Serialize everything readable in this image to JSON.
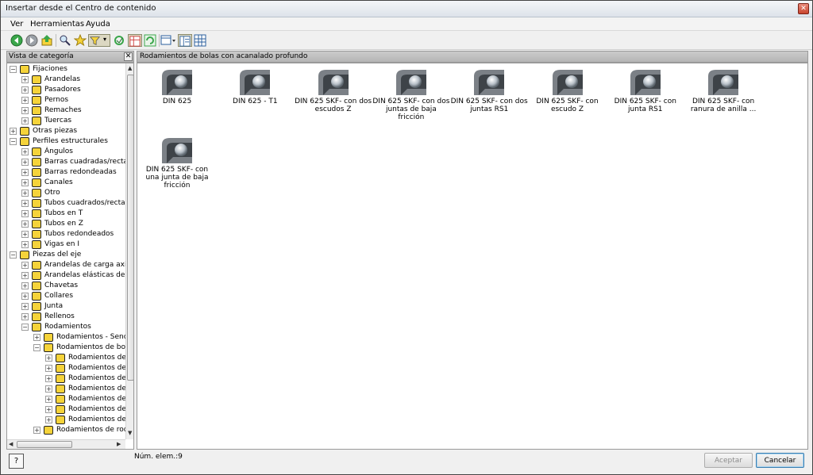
{
  "window": {
    "title": "Insertar desde el Centro de contenido"
  },
  "menu": [
    "Ver",
    "Herramientas",
    "Ayuda"
  ],
  "toolbar": {
    "icons": [
      "back-icon",
      "forward-icon",
      "up-icon",
      "search-icon",
      "favorites-icon",
      "filter-icon",
      "dropdown-icon",
      "refresh-check-icon",
      "table-view-icon",
      "refresh-icon",
      "view-mode-icon",
      "tree-view-icon",
      "grid-view-icon"
    ]
  },
  "sidebar": {
    "header": "Vista de categoría",
    "items": [
      {
        "label": "Fijaciones",
        "level": 0,
        "expanded": true
      },
      {
        "label": "Arandelas",
        "level": 1
      },
      {
        "label": "Pasadores",
        "level": 1
      },
      {
        "label": "Pernos",
        "level": 1
      },
      {
        "label": "Remaches",
        "level": 1
      },
      {
        "label": "Tuercas",
        "level": 1
      },
      {
        "label": "Otras piezas",
        "level": 0
      },
      {
        "label": "Perfiles estructurales",
        "level": 0,
        "expanded": true
      },
      {
        "label": "Ángulos",
        "level": 1
      },
      {
        "label": "Barras cuadradas/rectan",
        "level": 1
      },
      {
        "label": "Barras redondeadas",
        "level": 1
      },
      {
        "label": "Canales",
        "level": 1
      },
      {
        "label": "Otro",
        "level": 1
      },
      {
        "label": "Tubos cuadrados/rectang",
        "level": 1
      },
      {
        "label": "Tubos en T",
        "level": 1
      },
      {
        "label": "Tubos en Z",
        "level": 1
      },
      {
        "label": "Tubos redondeados",
        "level": 1
      },
      {
        "label": "Vigas en I",
        "level": 1
      },
      {
        "label": "Piezas del eje",
        "level": 0,
        "expanded": true
      },
      {
        "label": "Arandelas de carga axial",
        "level": 1
      },
      {
        "label": "Arandelas elásticas de re",
        "level": 1
      },
      {
        "label": "Chavetas",
        "level": 1
      },
      {
        "label": "Collares",
        "level": 1
      },
      {
        "label": "Junta",
        "level": 1
      },
      {
        "label": "Rellenos",
        "level": 1
      },
      {
        "label": "Rodamientos",
        "level": 1,
        "expanded": true
      },
      {
        "label": "Rodamientos - Sencill",
        "level": 2
      },
      {
        "label": "Rodamientos de bola",
        "level": 2,
        "expanded": true
      },
      {
        "label": "Rodamientos de l",
        "level": 3
      },
      {
        "label": "Rodamientos de l",
        "level": 3
      },
      {
        "label": "Rodamientos de l",
        "level": 3
      },
      {
        "label": "Rodamientos de l",
        "level": 3
      },
      {
        "label": "Rodamientos de l",
        "level": 3
      },
      {
        "label": "Rodamientos de l",
        "level": 3
      },
      {
        "label": "Rodamientos de l",
        "level": 3
      },
      {
        "label": "Rodamientos de rodil",
        "level": 2
      }
    ]
  },
  "content": {
    "header": "Rodamientos de bolas con acanalado profundo",
    "items": [
      "DIN 625",
      "DIN 625 - T1",
      "DIN 625 SKF- con dos escudos Z",
      "DIN 625 SKF- con dos juntas de baja fricción",
      "DIN 625 SKF- con dos juntas RS1",
      "DIN 625 SKF- con escudo Z",
      "DIN 625 SKF- con junta RS1",
      "DIN 625 SKF- con ranura de anilla ...",
      "DIN 625 SKF- con una junta de baja fricción"
    ]
  },
  "status": {
    "count": "Núm. elem.:9"
  },
  "buttons": {
    "accept": "Aceptar",
    "cancel": "Cancelar"
  }
}
